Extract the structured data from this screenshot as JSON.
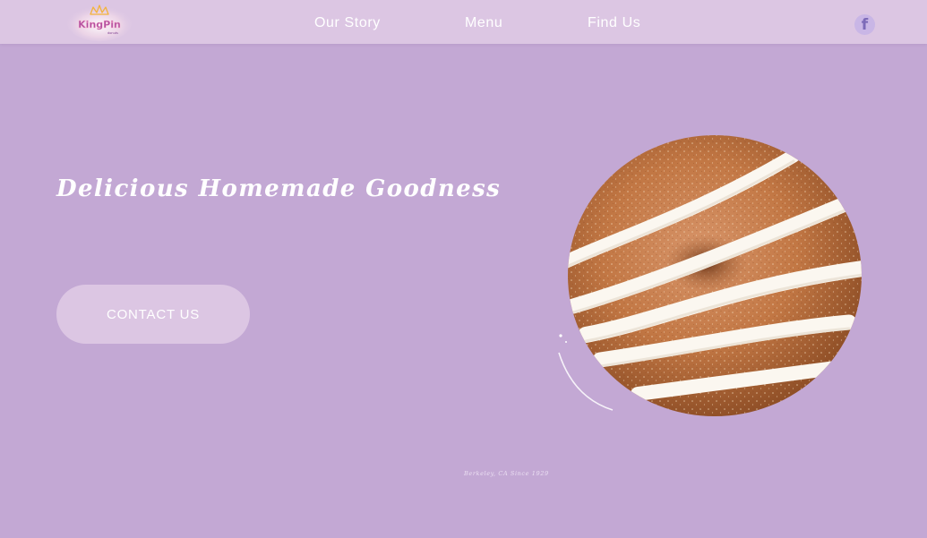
{
  "brand": {
    "logo_text": "KingPin",
    "logo_subtext": "donuts"
  },
  "nav": {
    "items": [
      {
        "label": "Our Story"
      },
      {
        "label": "Menu"
      },
      {
        "label": "Find Us"
      }
    ],
    "social_icon": "facebook-icon",
    "social_glyph": "f"
  },
  "hero": {
    "heading": "Delicious Homemade Goodness",
    "cta_label": "CONTACT US",
    "image": "donut-image"
  },
  "footer": {
    "note": "Berkeley, CA Since 1929"
  },
  "colors": {
    "background": "#c3a8d4",
    "navbar": "#dcc6e3",
    "button": "#dcc6e3",
    "text": "#ffffff"
  }
}
